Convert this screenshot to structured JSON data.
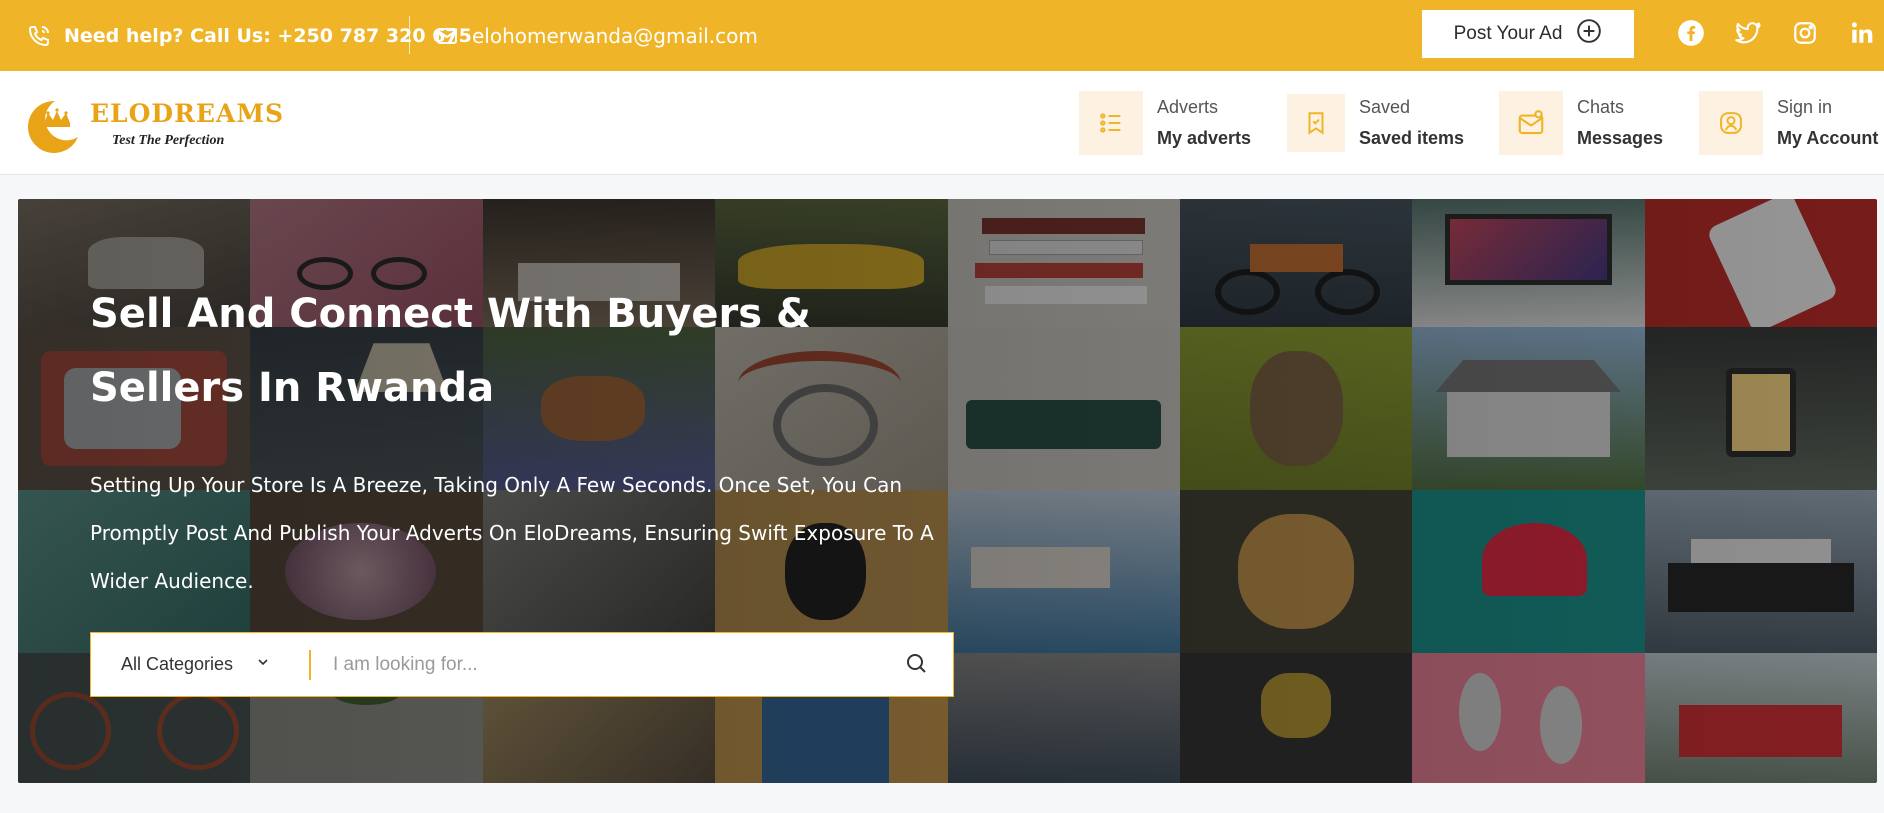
{
  "topbar": {
    "phone_text": "Need help? Call Us: +250 787 320 675",
    "email_text": "elohomerwanda@gmail.com",
    "post_ad_label": "Post Your Ad",
    "socials": [
      "facebook-icon",
      "twitter-icon",
      "instagram-icon",
      "linkedin-icon"
    ],
    "bg_color": "#f0b429"
  },
  "logo": {
    "brand": "ELODREAMS",
    "tagline": "Test The Perfection"
  },
  "nav": [
    {
      "small": "Adverts",
      "big": "My adverts",
      "icon": "list-icon"
    },
    {
      "small": "Saved",
      "big": "Saved items",
      "icon": "bookmark-icon"
    },
    {
      "small": "Chats",
      "big": "Messages",
      "icon": "mail-icon"
    },
    {
      "small": "Sign in",
      "big": "My Account",
      "icon": "user-icon"
    }
  ],
  "hero": {
    "title": "Sell And Connect With Buyers & Sellers In Rwanda",
    "subtitle": "Setting Up Your Store Is A Breeze, Taking Only A Few Seconds. Once Set, You Can Promptly Post And Publish Your Adverts On EloDreams, Ensuring Swift Exposure To A Wider Audience.",
    "search": {
      "category_label": "All Categories",
      "placeholder": "I am looking for..."
    }
  },
  "mosaic_tiles": [
    "sneakers-photo",
    "sunglasses-photo",
    "bedroom-photo",
    "sports-car-photo",
    "books-photo",
    "motorcycle-photo",
    "laptop-photo",
    "smartphone-photo",
    "retro-tv-photo",
    "lamp-photo",
    "dog-in-flowers-photo",
    "headphones-photo",
    "sofa-photo",
    "owl-photo",
    "house-photo",
    "lantern-photo",
    "face-masks-photo",
    "flower-bowl-photo",
    "keyboard-photo",
    "mouse-photo",
    "resort-pool-photo",
    "golden-retriever-photo",
    "red-cap-photo",
    "cruise-ship-photo",
    "bicycle-photo",
    "plant-stand-photo",
    "sewing-machine-photo",
    "window-photo",
    "clothes-rack-photo",
    "microphone-photo",
    "earrings-photo",
    "red-truck-photo"
  ]
}
